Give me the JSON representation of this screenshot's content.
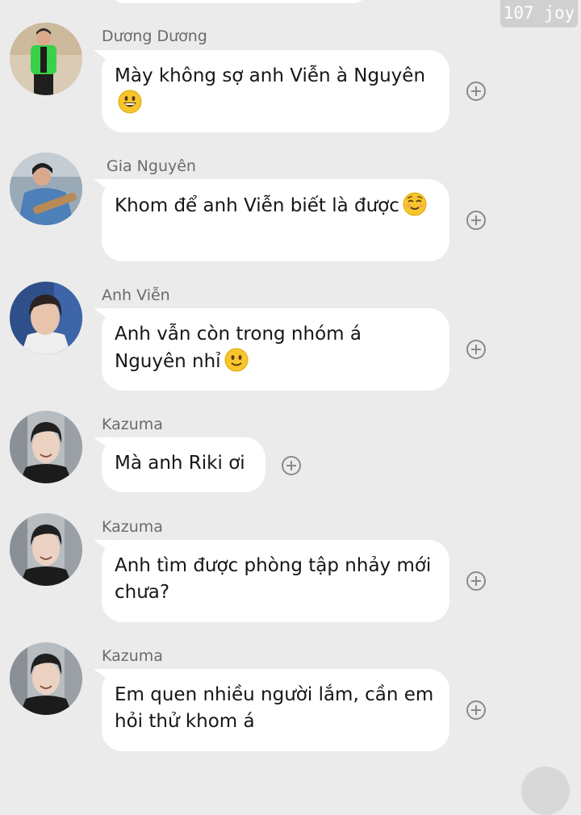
{
  "watermark": "107 joy",
  "messages": [
    {
      "sender": "Dương Dương",
      "text": "Mày không sợ anh Viễn à Nguyên",
      "emoji": "grinning-face",
      "avatar_icon": "avatar-green-jacket"
    },
    {
      "sender": "Gia Nguyên",
      "text": "Khom để anh Viễn biết là được",
      "emoji": "relieved-face",
      "avatar_icon": "avatar-guitarist"
    },
    {
      "sender": "Anh Viễn",
      "text": "Anh vẫn còn trong nhóm á Nguyên nhỉ",
      "emoji": "slightly-smiling-face",
      "avatar_icon": "avatar-blue-background"
    },
    {
      "sender": "Kazuma",
      "text": "Mà anh Riki ơi",
      "avatar_icon": "avatar-smiling-boy"
    },
    {
      "sender": "Kazuma",
      "text": "Anh tìm được phòng tập nhảy mới chưa?",
      "avatar_icon": "avatar-smiling-boy"
    },
    {
      "sender": "Kazuma",
      "text": "Em quen nhiều người lắm, cần em hỏi thử khom á",
      "avatar_icon": "avatar-smiling-boy"
    }
  ],
  "colors": {
    "background": "#ebebeb",
    "bubble": "#ffffff",
    "sender_name": "#6b6b6b",
    "message_text": "#161616",
    "react_icon": "#8a8a8a",
    "emoji_yellow": "#f7c52d"
  }
}
